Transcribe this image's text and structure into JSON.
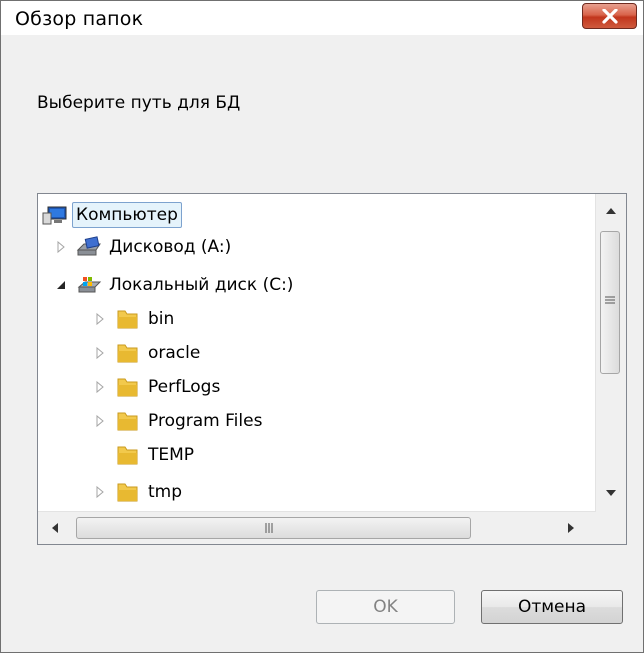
{
  "window": {
    "title": "Обзор папок"
  },
  "prompt": "Выберите путь для БД",
  "tree": {
    "items": [
      {
        "label": "Компьютер",
        "icon": "computer-icon",
        "level": 0,
        "expander": "none",
        "selected": true
      },
      {
        "label": "Дисковод (A:)",
        "icon": "floppy-drive-icon",
        "level": 1,
        "expander": "collapsed"
      },
      {
        "label": "Локальный диск (C:)",
        "icon": "local-disk-icon",
        "level": 1,
        "expander": "expanded"
      },
      {
        "label": "bin",
        "icon": "folder-icon",
        "level": 2,
        "expander": "collapsed"
      },
      {
        "label": "oracle",
        "icon": "folder-icon",
        "level": 2,
        "expander": "collapsed"
      },
      {
        "label": "PerfLogs",
        "icon": "folder-icon",
        "level": 2,
        "expander": "collapsed"
      },
      {
        "label": "Program Files",
        "icon": "folder-icon",
        "level": 2,
        "expander": "collapsed"
      },
      {
        "label": "TEMP",
        "icon": "folder-icon",
        "level": 2,
        "expander": "none"
      },
      {
        "label": "tmp",
        "icon": "folder-icon",
        "level": 2,
        "expander": "collapsed"
      }
    ]
  },
  "buttons": {
    "ok": "OK",
    "cancel": "Отмена"
  },
  "colors": {
    "close_button": "#c7432a",
    "selection_fill": "#e5f3fb",
    "selection_border": "#7da2ce",
    "folder": "#e8b931"
  }
}
